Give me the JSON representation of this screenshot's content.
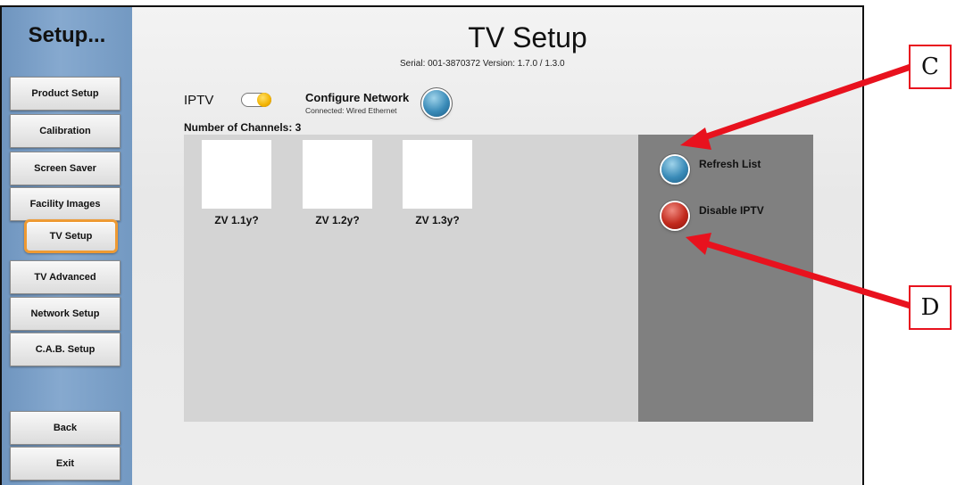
{
  "sidebar": {
    "title": "Setup...",
    "items": [
      {
        "label": "Product Setup",
        "active": false
      },
      {
        "label": "Calibration",
        "active": false
      },
      {
        "label": "Screen Saver",
        "active": false
      },
      {
        "label": "Facility Images",
        "active": false
      },
      {
        "label": "TV Setup",
        "active": true
      },
      {
        "label": "TV Advanced",
        "active": false
      },
      {
        "label": "Network Setup",
        "active": false
      },
      {
        "label": "C.A.B. Setup",
        "active": false
      }
    ],
    "bottom_items": [
      {
        "label": "Back"
      },
      {
        "label": "Exit"
      }
    ]
  },
  "header": {
    "title": "TV Setup",
    "serial_line": "Serial: 001-3870372  Version: 1.7.0 / 1.3.0"
  },
  "iptv": {
    "label": "IPTV",
    "toggle_on": true,
    "configure_title": "Configure Network",
    "connection_status": "Connected: Wired Ethernet"
  },
  "channels": {
    "count_label": "Number of Channels: 3",
    "items": [
      {
        "label": "ZV 1.1y?"
      },
      {
        "label": "ZV 1.2y?"
      },
      {
        "label": "ZV 1.3y?"
      }
    ]
  },
  "actions": {
    "refresh_label": "Refresh List",
    "disable_label": "Disable IPTV"
  },
  "callouts": {
    "c": "C",
    "d": "D"
  },
  "colors": {
    "accent_orange": "#ee9a33",
    "orb_blue": "#3a8bb8",
    "orb_red": "#c22a1d",
    "callout_red": "#e8121e"
  }
}
